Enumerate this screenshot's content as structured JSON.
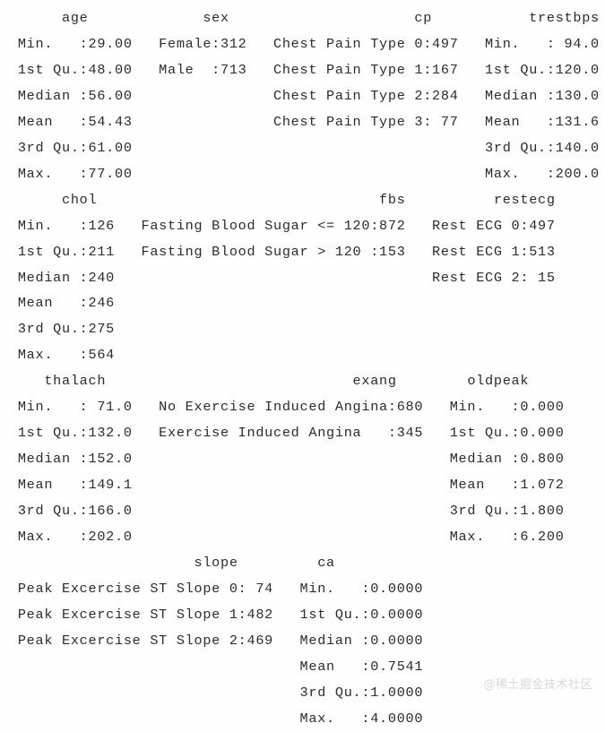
{
  "console": {
    "type": "r-summary-output",
    "background_color": "#fefefe",
    "text_color": "#2b2b2b",
    "font": "monospace",
    "blocks": [
      {
        "name": "block-1",
        "headers": [
          "age",
          "sex",
          "cp",
          "trestbps"
        ],
        "header_line": "      age             sex                     cp           trestbps    ",
        "lines": [
          " Min.   :29.00   Female:312   Chest Pain Type 0:497   Min.   : 94.0  ",
          " 1st Qu.:48.00   Male  :713   Chest Pain Type 1:167   1st Qu.:120.0  ",
          " Median :56.00                Chest Pain Type 2:284   Median :130.0  ",
          " Mean   :54.43                Chest Pain Type 3: 77   Mean   :131.6  ",
          " 3rd Qu.:61.00                                        3rd Qu.:140.0  ",
          " Max.   :77.00                                        Max.   :200.0  "
        ]
      },
      {
        "name": "block-2",
        "headers": [
          "chol",
          "fbs",
          "restecg"
        ],
        "header_line": "      chol                                fbs          restecg    ",
        "lines": [
          " Min.   :126   Fasting Blood Sugar <= 120:872   Rest ECG 0:497  ",
          " 1st Qu.:211   Fasting Blood Sugar > 120 :153   Rest ECG 1:513  ",
          " Median :240                                    Rest ECG 2: 15  ",
          " Mean   :246                                                    ",
          " 3rd Qu.:275                                                    ",
          " Max.   :564                                                    "
        ]
      },
      {
        "name": "block-3",
        "headers": [
          "thalach",
          "exang",
          "oldpeak"
        ],
        "header_line": "    thalach                            exang        oldpeak     ",
        "lines": [
          " Min.   : 71.0   No Exercise Induced Angina:680   Min.   :0.000  ",
          " 1st Qu.:132.0   Exercise Induced Angina   :345   1st Qu.:0.000  ",
          " Median :152.0                                    Median :0.800  ",
          " Mean   :149.1                                    Mean   :1.072  ",
          " 3rd Qu.:166.0                                    3rd Qu.:1.800  ",
          " Max.   :202.0                                    Max.   :6.200  "
        ]
      },
      {
        "name": "block-4",
        "headers": [
          "slope",
          "ca"
        ],
        "header_line": "                     slope         ca        ",
        "lines": [
          " Peak Excercise ST Slope 0: 74   Min.   :0.0000  ",
          " Peak Excercise ST Slope 1:482   1st Qu.:0.0000  ",
          " Peak Excercise ST Slope 2:469   Median :0.0000  ",
          "                                 Mean   :0.7541  ",
          "                                 3rd Qu.:1.0000  ",
          "                                 Max.   :4.0000  "
        ]
      }
    ],
    "full_text": "      age             sex                     cp           trestbps    \n Min.   :29.00   Female:312   Chest Pain Type 0:497   Min.   : 94.0  \n 1st Qu.:48.00   Male  :713   Chest Pain Type 1:167   1st Qu.:120.0  \n Median :56.00                Chest Pain Type 2:284   Median :130.0  \n Mean   :54.43                Chest Pain Type 3: 77   Mean   :131.6  \n 3rd Qu.:61.00                                        3rd Qu.:140.0  \n Max.   :77.00                                        Max.   :200.0  \n      chol                                fbs          restecg    \n Min.   :126   Fasting Blood Sugar <= 120:872   Rest ECG 0:497  \n 1st Qu.:211   Fasting Blood Sugar > 120 :153   Rest ECG 1:513  \n Median :240                                    Rest ECG 2: 15  \n Mean   :246                                                    \n 3rd Qu.:275                                                    \n Max.   :564                                                    \n    thalach                            exang        oldpeak     \n Min.   : 71.0   No Exercise Induced Angina:680   Min.   :0.000  \n 1st Qu.:132.0   Exercise Induced Angina   :345   1st Qu.:0.000  \n Median :152.0                                    Median :0.800  \n Mean   :149.1                                    Mean   :1.072  \n 3rd Qu.:166.0                                    3rd Qu.:1.800  \n Max.   :202.0                                    Max.   :6.200  \n                     slope         ca        \n Peak Excercise ST Slope 0: 74   Min.   :0.0000  \n Peak Excercise ST Slope 1:482   1st Qu.:0.0000  \n Peak Excercise ST Slope 2:469   Median :0.0000  \n                                 Mean   :0.7541  \n                                 3rd Qu.:1.0000  \n                                 Max.   :4.0000  "
  },
  "stats": {
    "age": {
      "label": "age",
      "min": "29.00",
      "q1": "48.00",
      "median": "56.00",
      "mean": "54.43",
      "q3": "61.00",
      "max": "77.00"
    },
    "sex": {
      "label": "sex",
      "levels": [
        {
          "name": "Female",
          "count": 312
        },
        {
          "name": "Male",
          "count": 713
        }
      ]
    },
    "cp": {
      "label": "cp",
      "levels": [
        {
          "name": "Chest Pain Type 0",
          "count": 497
        },
        {
          "name": "Chest Pain Type 1",
          "count": 167
        },
        {
          "name": "Chest Pain Type 2",
          "count": 284
        },
        {
          "name": "Chest Pain Type 3",
          "count": 77
        }
      ]
    },
    "trestbps": {
      "label": "trestbps",
      "min": "94.0",
      "q1": "120.0",
      "median": "130.0",
      "mean": "131.6",
      "q3": "140.0",
      "max": "200.0"
    },
    "chol": {
      "label": "chol",
      "min": "126",
      "q1": "211",
      "median": "240",
      "mean": "246",
      "q3": "275",
      "max": "564"
    },
    "fbs": {
      "label": "fbs",
      "levels": [
        {
          "name": "Fasting Blood Sugar <= 120",
          "count": 872
        },
        {
          "name": "Fasting Blood Sugar > 120",
          "count": 153
        }
      ]
    },
    "restecg": {
      "label": "restecg",
      "levels": [
        {
          "name": "Rest ECG 0",
          "count": 497
        },
        {
          "name": "Rest ECG 1",
          "count": 513
        },
        {
          "name": "Rest ECG 2",
          "count": 15
        }
      ]
    },
    "thalach": {
      "label": "thalach",
      "min": "71.0",
      "q1": "132.0",
      "median": "152.0",
      "mean": "149.1",
      "q3": "166.0",
      "max": "202.0"
    },
    "exang": {
      "label": "exang",
      "levels": [
        {
          "name": "No Exercise Induced Angina",
          "count": 680
        },
        {
          "name": "Exercise Induced Angina",
          "count": 345
        }
      ]
    },
    "oldpeak": {
      "label": "oldpeak",
      "min": "0.000",
      "q1": "0.000",
      "median": "0.800",
      "mean": "1.072",
      "q3": "1.800",
      "max": "6.200"
    },
    "slope": {
      "label": "slope",
      "levels": [
        {
          "name": "Peak Excercise ST Slope 0",
          "count": 74
        },
        {
          "name": "Peak Excercise ST Slope 1",
          "count": 482
        },
        {
          "name": "Peak Excercise ST Slope 2",
          "count": 469
        }
      ]
    },
    "ca": {
      "label": "ca",
      "min": "0.0000",
      "q1": "0.0000",
      "median": "0.0000",
      "mean": "0.7541",
      "q3": "1.0000",
      "max": "4.0000"
    }
  },
  "row_labels": [
    "Min.",
    "1st Qu.",
    "Median",
    "Mean",
    "3rd Qu.",
    "Max."
  ],
  "watermark": {
    "text": "@稀土掘金技术社区",
    "color": "#d8d8d8"
  }
}
